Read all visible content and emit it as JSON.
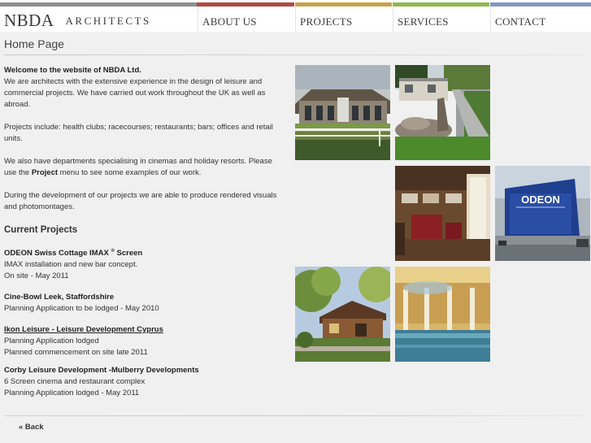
{
  "brand": {
    "name": "NBDA",
    "subtitle": "ARCHITECTS"
  },
  "nav": {
    "items": [
      {
        "label": "ABOUT US",
        "color": "#c1c1c1"
      },
      {
        "label": "PROJECTS",
        "color": "#c8a24a"
      },
      {
        "label": "SERVICES",
        "color": "#8fb84f"
      },
      {
        "label": "CONTACT",
        "color": "#7f95c4"
      }
    ],
    "brand_strip_colors": [
      "#8e8e8e",
      "#b04a44"
    ]
  },
  "page": {
    "title": "Home Page"
  },
  "intro": {
    "welcome": "Welcome to the website of NBDA Ltd.",
    "p1": "We are architects with the extensive experience in the design of leisure and commercial projects. We have carried out work throughout the UK as well as abroad.",
    "p2": "Projects include: health clubs; racecourses; restaurants; bars; offices and retail units.",
    "p3_before": "We also have departments specialising in cinemas and holiday resorts. Please use the ",
    "p3_bold": "Project",
    "p3_after": " menu to see some examples of our work.",
    "p4": "During the development of our projects we are able to produce rendered visuals and photomontages."
  },
  "current_projects": {
    "heading": "Current Projects",
    "items": [
      {
        "title": "ODEON Swiss Cottage IMAX",
        "sup": "®",
        "title_after": " Screen",
        "lines": [
          "IMAX installation and new bar concept.",
          "On site - May 2011"
        ]
      },
      {
        "title": "Cine-Bowl Leek, Staffordshire",
        "lines": [
          "Planning Application to be lodged - May 2010"
        ]
      },
      {
        "title": "Ikon Leisure - Leisure Development Cyprus ",
        "link": true,
        "lines": [
          "Planning Application lodged",
          "Planned commencement on site late 2011"
        ]
      },
      {
        "title": "Corby Leisure Development -Mulberry Developments",
        "lines": [
          "6 Screen cinema and restaurant complex",
          "Planning Application lodged - May 2011"
        ]
      }
    ]
  },
  "photos": {
    "odeon_sign": "ODEON"
  },
  "footer": {
    "back": "« Back"
  }
}
